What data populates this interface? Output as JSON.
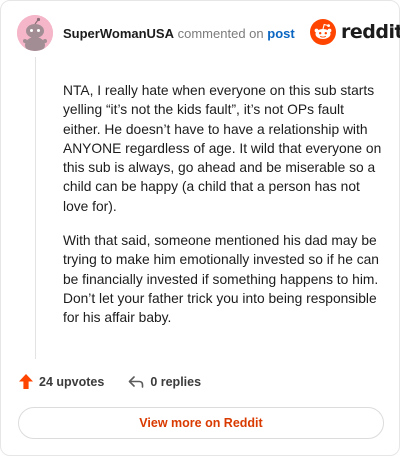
{
  "header": {
    "author": "SuperWomanUSA",
    "action": "commented on",
    "target": "post"
  },
  "logo": {
    "icon": "reddit-alien-icon",
    "wordmark": "reddit",
    "color": "#ff4500"
  },
  "comment": {
    "paragraphs": [
      "NTA, I really hate when everyone on this sub starts yelling “it’s not the kids fault”, it’s not OPs fault either. He doesn’t have to have a relationship with ANYONE regardless of age. It wild that everyone on this sub is always, go ahead and be miserable so a child can be happy (a child that a person has not love for).",
      "With that said, someone mentioned his dad may be trying to make him emotionally invested so if he can be financially invested if something happens to him. Don’t let your father trick you into being responsible for his affair baby."
    ]
  },
  "actions": {
    "upvotes": "24 upvotes",
    "replies": "0 replies",
    "upvote_icon": "upvote-arrow-icon",
    "reply_icon": "reply-arrow-icon",
    "upvote_color": "#ff4500"
  },
  "footer": {
    "view_more": "View more on Reddit",
    "accent": "#d93a00"
  }
}
